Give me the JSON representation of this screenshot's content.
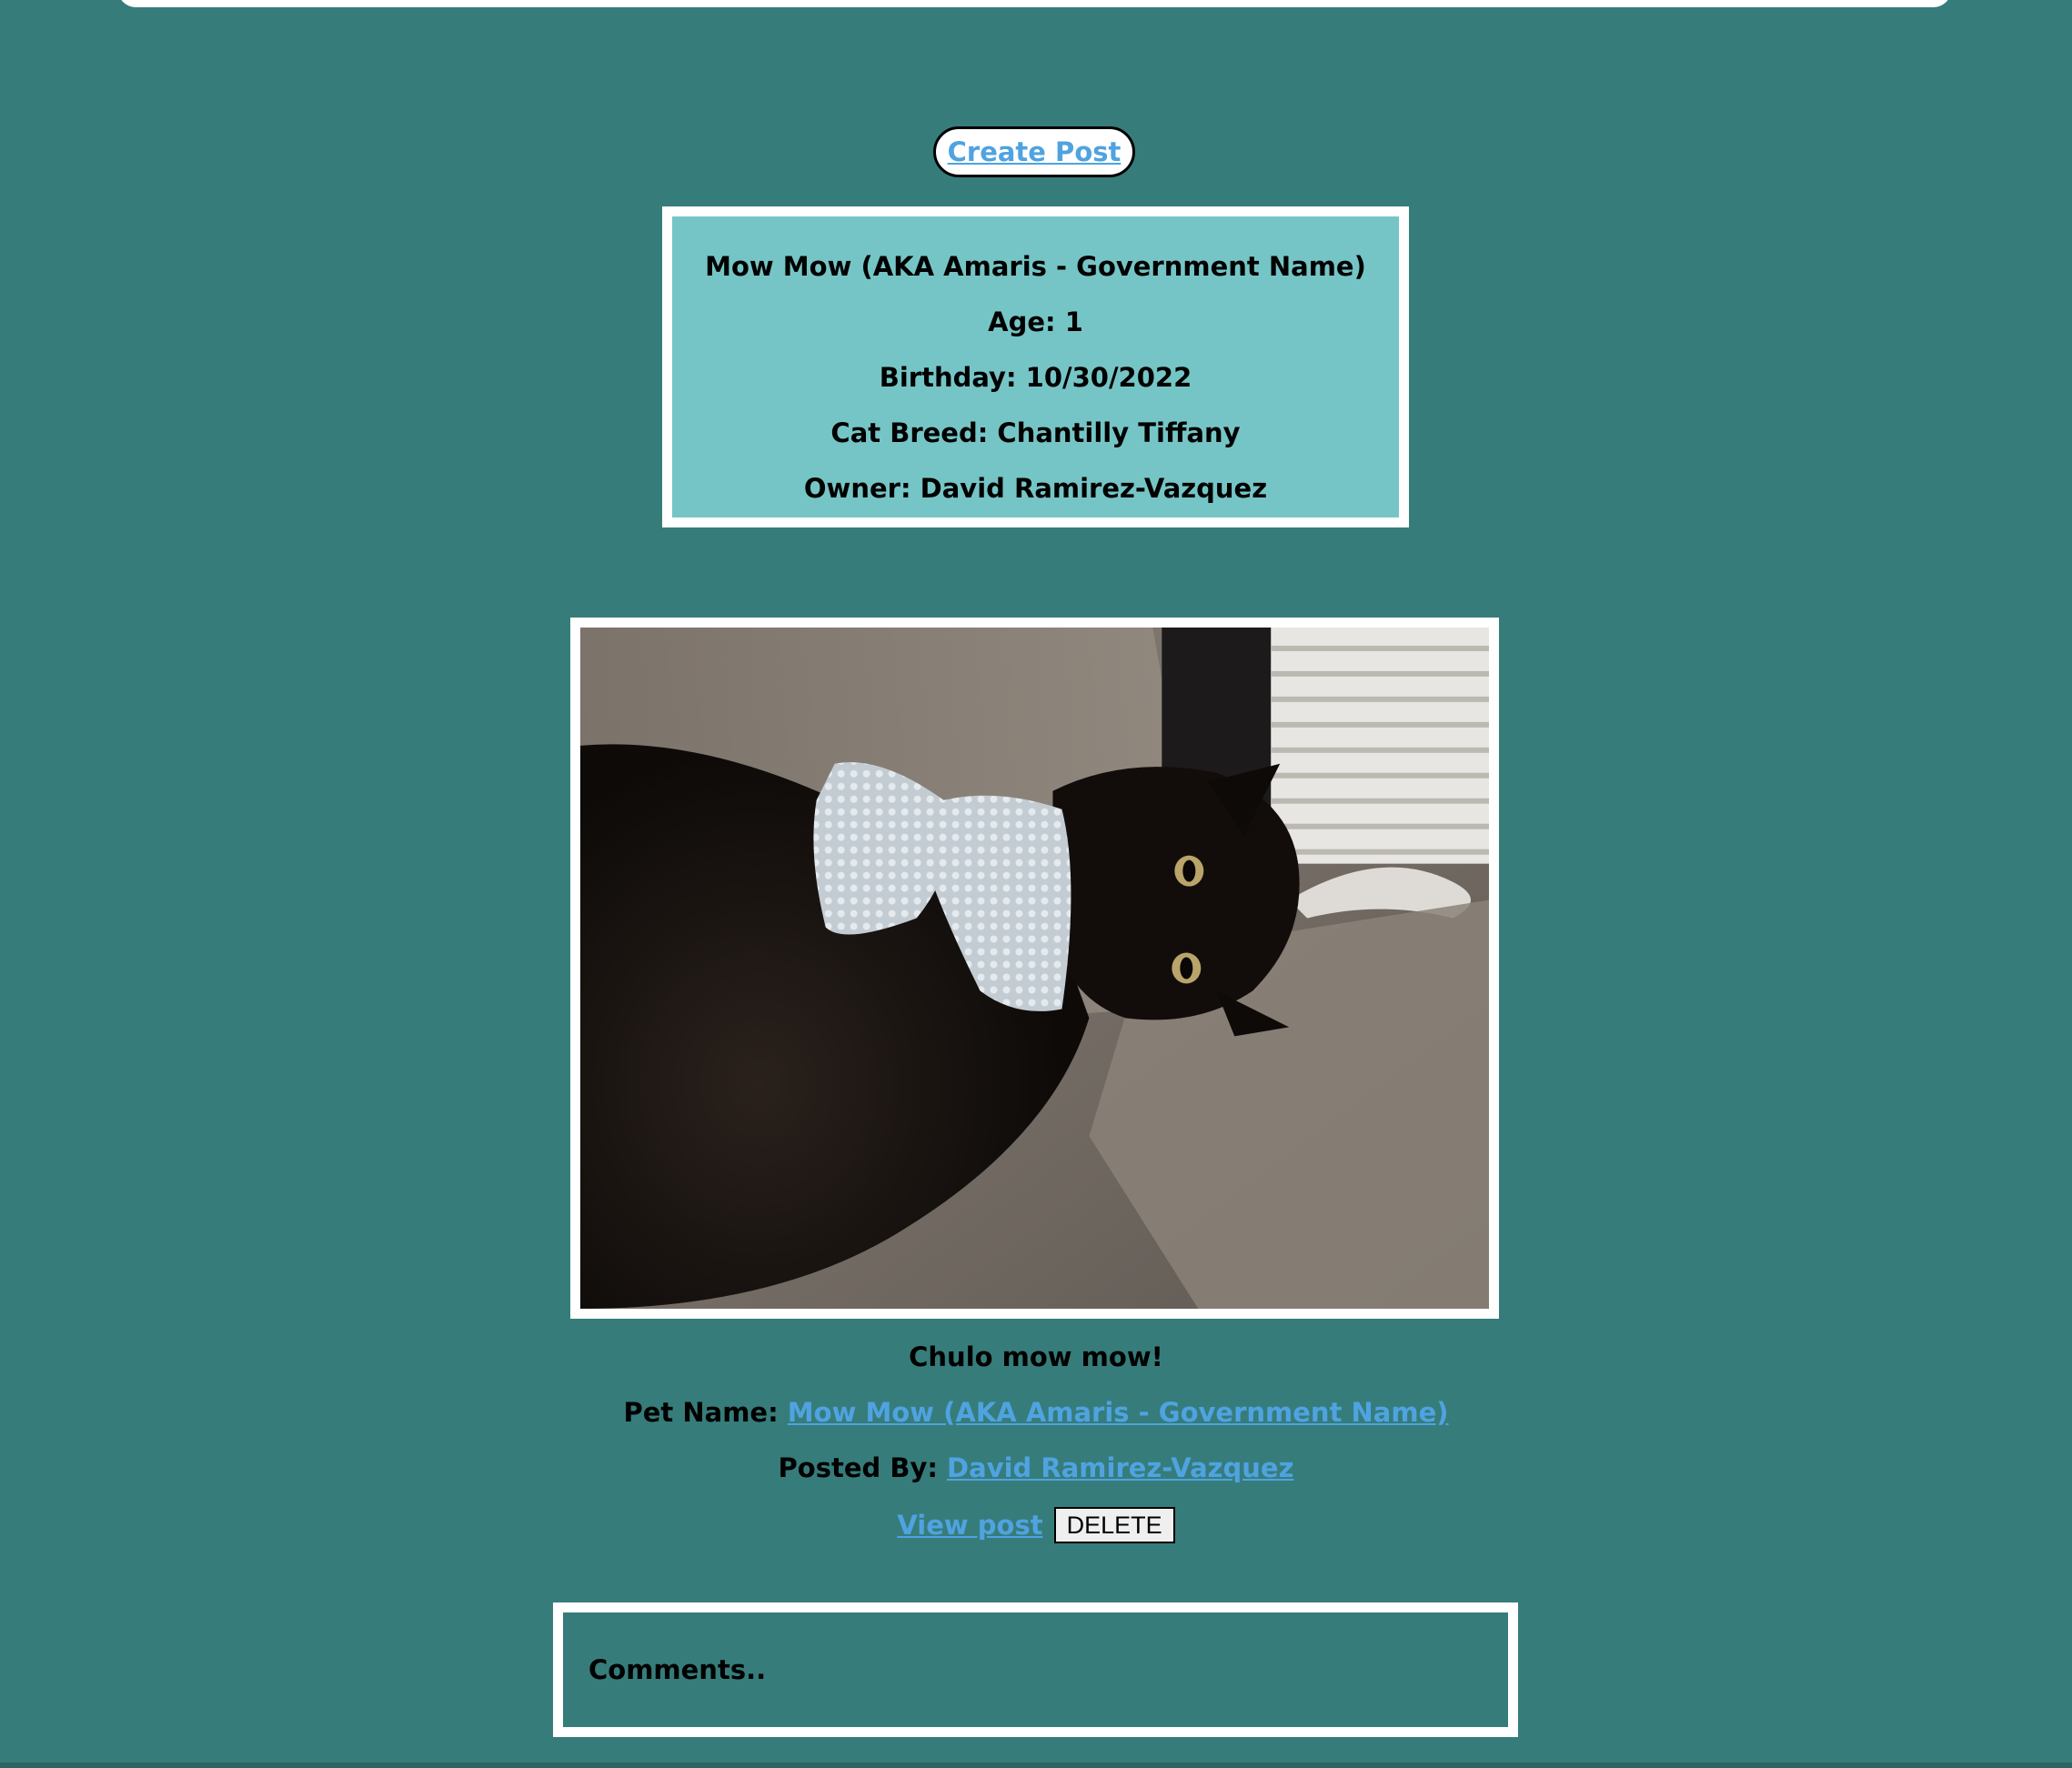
{
  "nav": {
    "create_post_label": "Create Post"
  },
  "pet": {
    "name_line": "Mow Mow (AKA Amaris - Government Name)",
    "age_line": "Age: 1",
    "birthday_line": "Birthday: 10/30/2022",
    "breed_line": "Cat Breed: Chantilly Tiffany",
    "owner_line": "Owner: David Ramirez-Vazquez"
  },
  "post": {
    "caption": "Chulo mow mow!",
    "pet_name_label": "Pet Name: ",
    "pet_name_link": "Mow Mow (AKA Amaris - Government Name)",
    "posted_by_label": "Posted By: ",
    "posted_by_link": "David Ramirez-Vazquez",
    "view_post_label": "View post",
    "delete_label": "DELETE"
  },
  "comments": {
    "heading": "Comments.."
  },
  "colors": {
    "page_background": "#367c7b",
    "card_background": "#76c5c6",
    "link": "#4fa3e0",
    "border": "#ffffff"
  }
}
